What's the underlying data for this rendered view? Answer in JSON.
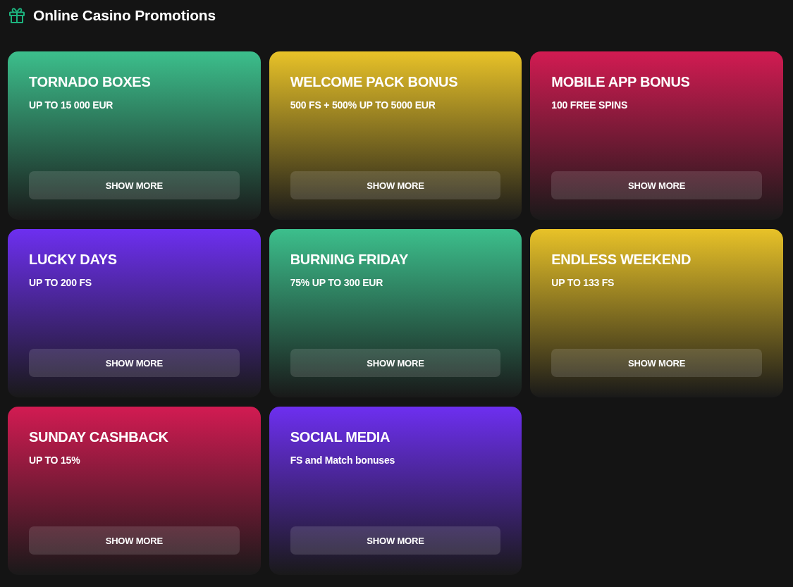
{
  "header": {
    "title": "Online Casino Promotions"
  },
  "promotions": [
    {
      "title": "TORNADO BOXES",
      "subtitle": "UP TO 15 000 EUR",
      "button": "SHOW MORE",
      "color": "#3cbf8c"
    },
    {
      "title": "WELCOME PACK BONUS",
      "subtitle": "500 FS + 500% UP TO 5000 EUR",
      "button": "SHOW MORE",
      "color": "#e8c228"
    },
    {
      "title": "MOBILE APP BONUS",
      "subtitle": "100 FREE SPINS",
      "button": "SHOW MORE",
      "color": "#d21b52"
    },
    {
      "title": "LUCKY DAYS",
      "subtitle": "UP TO 200 FS",
      "button": "SHOW MORE",
      "color": "#6d2ff0"
    },
    {
      "title": "BURNING FRIDAY",
      "subtitle": "75% UP TO 300 EUR",
      "button": "SHOW MORE",
      "color": "#3cbf8c"
    },
    {
      "title": "ENDLESS WEEKEND",
      "subtitle": "UP TO 133 FS",
      "button": "SHOW MORE",
      "color": "#e8c228"
    },
    {
      "title": "SUNDAY CASHBACK",
      "subtitle": "UP TO 15%",
      "button": "SHOW MORE",
      "color": "#d21b52"
    },
    {
      "title": "SOCIAL MEDIA",
      "subtitle": "FS and Match bonuses",
      "button": "SHOW MORE",
      "color": "#6d2ff0"
    }
  ]
}
